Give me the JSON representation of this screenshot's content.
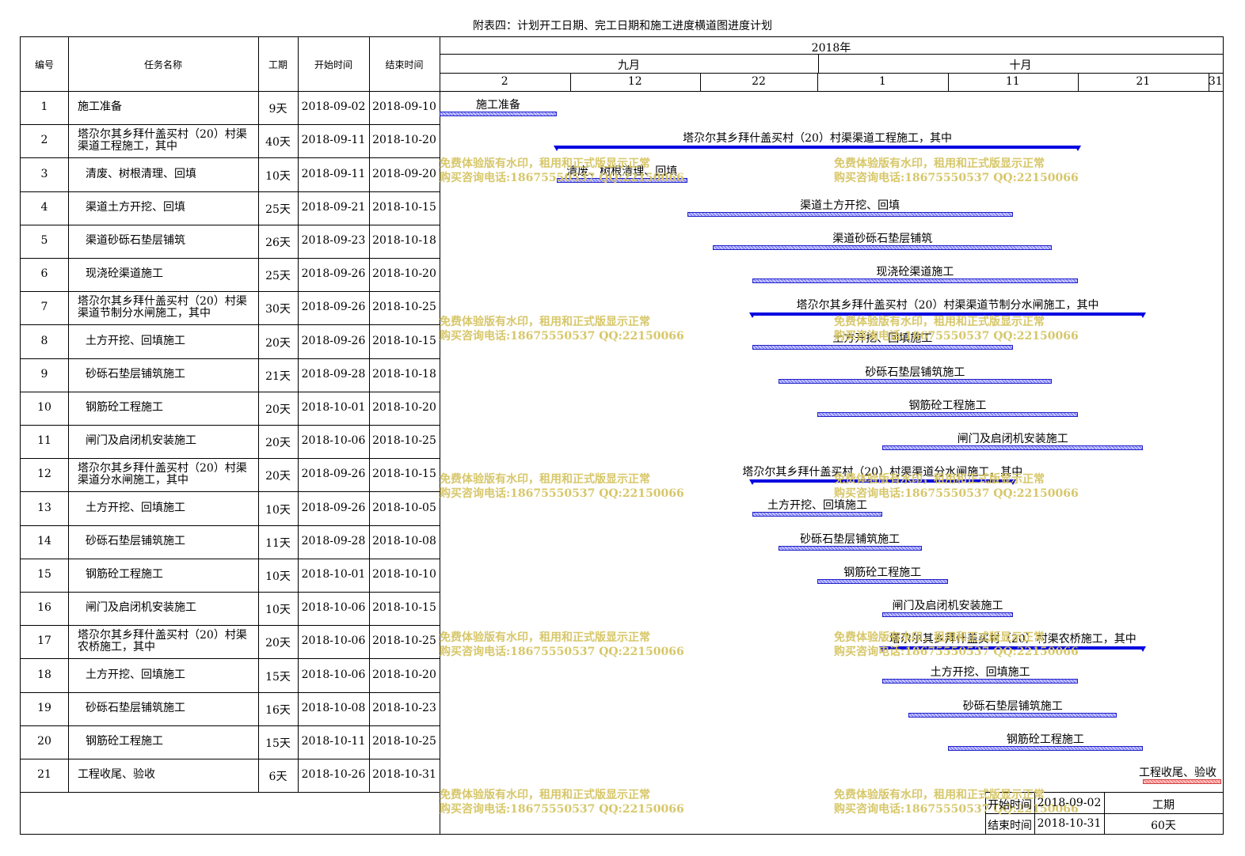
{
  "title": "附表四：计划开工日期、完工日期和施工进度横道图进度计划",
  "headers": {
    "id": "编号",
    "name": "任务名称",
    "duration": "工期",
    "start": "开始时间",
    "end": "结束时间",
    "year": "2018年",
    "month1": "九月",
    "month2": "十月"
  },
  "chart_data": {
    "type": "gantt",
    "x_range": [
      "2018-09-02",
      "2018-10-31"
    ],
    "ticks": [
      "2",
      "12",
      "22",
      "1",
      "11",
      "21",
      "31"
    ],
    "tasks": [
      {
        "id": "1",
        "name": "施工准备",
        "duration": "9天",
        "start": "2018-09-02",
        "end": "2018-09-10",
        "summary": false
      },
      {
        "id": "2",
        "name": "塔尕尔其乡拜什盖买村（20）村渠渠道工程施工，其中",
        "duration": "40天",
        "start": "2018-09-11",
        "end": "2018-10-20",
        "summary": true
      },
      {
        "id": "3",
        "name": "清废、树根清理、回填",
        "duration": "10天",
        "start": "2018-09-11",
        "end": "2018-09-20",
        "summary": false
      },
      {
        "id": "4",
        "name": "渠道土方开挖、回填",
        "duration": "25天",
        "start": "2018-09-21",
        "end": "2018-10-15",
        "summary": false
      },
      {
        "id": "5",
        "name": "渠道砂砾石垫层铺筑",
        "duration": "26天",
        "start": "2018-09-23",
        "end": "2018-10-18",
        "summary": false
      },
      {
        "id": "6",
        "name": "现浇砼渠道施工",
        "duration": "25天",
        "start": "2018-09-26",
        "end": "2018-10-20",
        "summary": false
      },
      {
        "id": "7",
        "name": "塔尕尔其乡拜什盖买村（20）村渠渠道节制分水闸施工，其中",
        "duration": "30天",
        "start": "2018-09-26",
        "end": "2018-10-25",
        "summary": true
      },
      {
        "id": "8",
        "name": "土方开挖、回填施工",
        "duration": "20天",
        "start": "2018-09-26",
        "end": "2018-10-15",
        "summary": false
      },
      {
        "id": "9",
        "name": "砂砾石垫层铺筑施工",
        "duration": "21天",
        "start": "2018-09-28",
        "end": "2018-10-18",
        "summary": false
      },
      {
        "id": "10",
        "name": "钢筋砼工程施工",
        "duration": "20天",
        "start": "2018-10-01",
        "end": "2018-10-20",
        "summary": false
      },
      {
        "id": "11",
        "name": "闸门及启闭机安装施工",
        "duration": "20天",
        "start": "2018-10-06",
        "end": "2018-10-25",
        "summary": false
      },
      {
        "id": "12",
        "name": "塔尕尔其乡拜什盖买村（20）村渠渠道分水闸施工，其中",
        "duration": "20天",
        "start": "2018-09-26",
        "end": "2018-10-15",
        "summary": true
      },
      {
        "id": "13",
        "name": "土方开挖、回填施工",
        "duration": "10天",
        "start": "2018-09-26",
        "end": "2018-10-05",
        "summary": false
      },
      {
        "id": "14",
        "name": "砂砾石垫层铺筑施工",
        "duration": "11天",
        "start": "2018-09-28",
        "end": "2018-10-08",
        "summary": false
      },
      {
        "id": "15",
        "name": "钢筋砼工程施工",
        "duration": "10天",
        "start": "2018-10-01",
        "end": "2018-10-10",
        "summary": false
      },
      {
        "id": "16",
        "name": "闸门及启闭机安装施工",
        "duration": "10天",
        "start": "2018-10-06",
        "end": "2018-10-15",
        "summary": false
      },
      {
        "id": "17",
        "name": "塔尕尔其乡拜什盖买村（20）村渠农桥施工，其中",
        "duration": "20天",
        "start": "2018-10-06",
        "end": "2018-10-25",
        "summary": true
      },
      {
        "id": "18",
        "name": "土方开挖、回填施工",
        "duration": "15天",
        "start": "2018-10-06",
        "end": "2018-10-20",
        "summary": false
      },
      {
        "id": "19",
        "name": "砂砾石垫层铺筑施工",
        "duration": "16天",
        "start": "2018-10-08",
        "end": "2018-10-23",
        "summary": false
      },
      {
        "id": "20",
        "name": "钢筋砼工程施工",
        "duration": "15天",
        "start": "2018-10-11",
        "end": "2018-10-25",
        "summary": false
      },
      {
        "id": "21",
        "name": "工程收尾、验收",
        "duration": "6天",
        "start": "2018-10-26",
        "end": "2018-10-31",
        "summary": false
      }
    ]
  },
  "bar_labels": [
    "施工准备",
    "塔尕尔其乡拜什盖买村（20）村渠渠道工程施工，其中",
    "清废、树根清理、回填",
    "渠道土方开挖、回填",
    "渠道砂砾石垫层铺筑",
    "现浇砼渠道施工",
    "塔尕尔其乡拜什盖买村（20）村渠渠道节制分水闸施工，其中",
    "土方开挖、回填施工",
    "砂砾石垫层铺筑施工",
    "钢筋砼工程施工",
    "闸门及启闭机安装施工",
    "塔尕尔其乡拜什盖买村（20）村渠渠道分水闸施工，其中",
    "土方开挖、回填施工",
    "砂砾石垫层铺筑施工",
    "钢筋砼工程施工",
    "闸门及启闭机安装施工",
    "塔尕尔其乡拜什盖买村（20）村渠农桥施工，其中",
    "土方开挖、回填施工",
    "砂砾石垫层铺筑施工",
    "钢筋砼工程施工",
    "工程收尾、验收"
  ],
  "footer": {
    "start_label": "开始时间",
    "start_value": "2018-09-02",
    "end_label": "结束时间",
    "end_value": "2018-10-31",
    "duration_label": "工期",
    "duration_value": "60天"
  },
  "watermark": {
    "line1": "免费体验版有水印，租用和正式版显示正常",
    "line2": "购买咨询电话:18675550537 QQ:22150066"
  },
  "colors": {
    "bar": "#6a6aff",
    "summary": "#0000e0",
    "final_bar": "#ff6a6a",
    "watermark": "#d7c76a"
  }
}
